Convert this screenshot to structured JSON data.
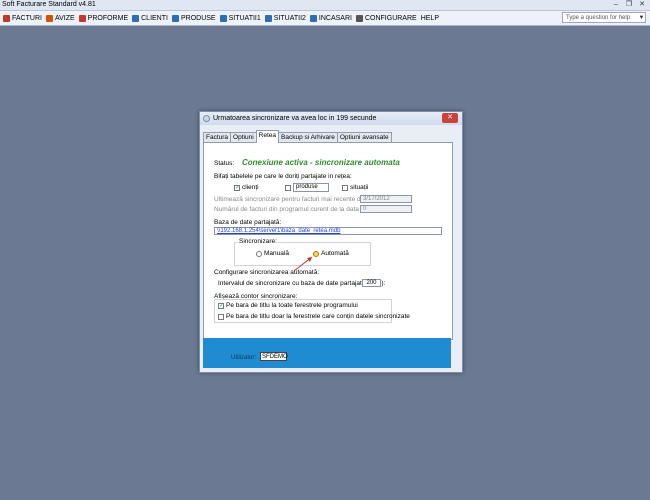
{
  "app": {
    "title": "Soft Facturare Standard v4.81"
  },
  "window_controls": {
    "minimize": "–",
    "restore": "❐",
    "close": "✕"
  },
  "menu": {
    "items": [
      {
        "label": "FACTURI",
        "icon": "invoice-icon",
        "color": "#c0392b"
      },
      {
        "label": "AVIZE",
        "icon": "delivery-note-icon",
        "color": "#d35400"
      },
      {
        "label": "PROFORME",
        "icon": "proforma-icon",
        "color": "#c0392b"
      },
      {
        "label": "CLIENTI",
        "icon": "clients-icon",
        "color": "#2c6fb8"
      },
      {
        "label": "PRODUSE",
        "icon": "products-icon",
        "color": "#2c6fb8"
      },
      {
        "label": "SITUATII1",
        "icon": "report-icon",
        "color": "#2c6fb8"
      },
      {
        "label": "SITUATII2",
        "icon": "report-icon",
        "color": "#2c6fb8"
      },
      {
        "label": "INCASARI",
        "icon": "receipts-icon",
        "color": "#2c6fb8"
      },
      {
        "label": "CONFIGURARE",
        "icon": "settings-icon",
        "color": "#555555"
      },
      {
        "label": "HELP",
        "icon": "",
        "color": ""
      }
    ],
    "help_placeholder": "Type a question for help"
  },
  "dialog": {
    "title": "Urmatoarea sincronizare va avea loc in 199 secunde",
    "close_label": "✕",
    "tabs": [
      "Factura",
      "Optiuni",
      "Retea",
      "Backup si Arhivare",
      "Optiuni avansate"
    ],
    "active_tab": "Retea",
    "status_label": "Status:",
    "status_value": "Conexiune activa - sincronizare automata",
    "status_color": "#2e8a2e",
    "tables_label": "Bifați tabelele pe care le doriți partajate in rețea:",
    "tables": [
      {
        "label": "clienți",
        "checked": true
      },
      {
        "label": "produse",
        "checked": false
      },
      {
        "label": "situații",
        "checked": false
      }
    ],
    "last_sync_label": "Ultimează sincronizare pentru facturi mai recente de:",
    "last_sync_value": "3/17/2012",
    "invoice_count_label": "Numărul de facturi din programul curent de la data aleasă:",
    "invoice_count_value": "0",
    "db_label": "Baza de date partajată:",
    "db_path": "\\\\192.168.1.254\\server1\\baza_date_retea.mdb",
    "sync_group_label": "Sincronizare:",
    "sync_manual": "Manuală",
    "sync_auto": "Automată",
    "auto_sync_label": "Configurare sincronizarea automată:",
    "interval_label": "Intervalul de sincronizare cu baza de date partajată (sec.):",
    "interval_value": "200",
    "counter_label": "Afișează contor sincronizare:",
    "counter_option_1": "Pe bara de titlu la toate ferestrele programului",
    "counter_option_2": "Pe bara de titlu doar la ferestrele care conțin datele sincronizate",
    "counter_option_1_checked": true,
    "counter_option_2_checked": false,
    "user_label": "Utilizator:",
    "user_value": "SFDEMO",
    "bottom_bar_color": "#1f8bd0"
  }
}
